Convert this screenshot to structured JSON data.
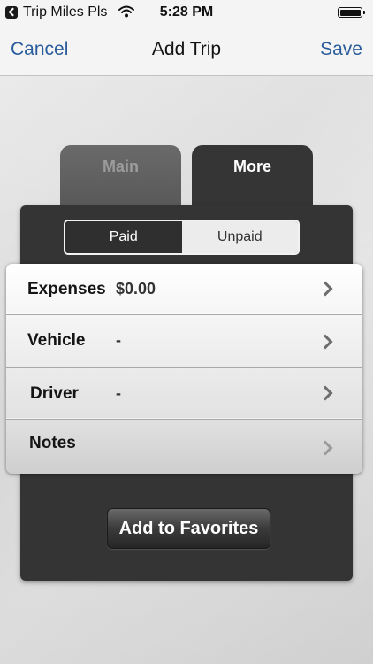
{
  "status_bar": {
    "app_name": "Trip Miles Pls",
    "time": "5:28 PM"
  },
  "nav": {
    "cancel_label": "Cancel",
    "title": "Add Trip",
    "save_label": "Save"
  },
  "tabs": [
    {
      "label": "Main",
      "selected": false
    },
    {
      "label": "More",
      "selected": true
    }
  ],
  "payment_status": {
    "options": [
      "Paid",
      "Unpaid"
    ],
    "selected": "Paid"
  },
  "details": [
    {
      "label": "Expenses",
      "value": "$0.00"
    },
    {
      "label": "Vehicle",
      "value": "-"
    },
    {
      "label": "Driver",
      "value": "-"
    },
    {
      "label": "Notes",
      "value": ""
    }
  ],
  "favorites_button_label": "Add to Favorites",
  "colors": {
    "nav_link": "#2a5c9c",
    "panel": "#343434",
    "tab_inactive_text": "#9c9c9c"
  },
  "icons": {
    "back": "back-arrow-icon",
    "wifi": "wifi-icon",
    "battery": "battery-icon",
    "row_disclosure": "chevron-right-icon"
  }
}
